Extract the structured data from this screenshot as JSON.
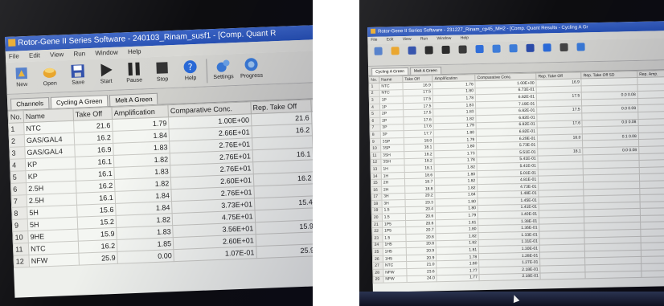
{
  "left": {
    "window_title": "Rotor-Gene II Series Software - 240103_Rinam_susf1 - [Comp. Quant R",
    "menu": [
      "File",
      "Edit",
      "View",
      "Run",
      "Window",
      "Help"
    ],
    "toolbar": [
      {
        "label": "New",
        "icon": "new-icon"
      },
      {
        "label": "Open",
        "icon": "open-icon"
      },
      {
        "label": "Save",
        "icon": "save-icon"
      },
      {
        "label": "Start",
        "icon": "play-icon"
      },
      {
        "label": "Pause",
        "icon": "pause-icon"
      },
      {
        "label": "Stop",
        "icon": "stop-icon"
      },
      {
        "label": "Help",
        "icon": "help-icon"
      },
      {
        "label": "Settings",
        "icon": "settings-icon"
      },
      {
        "label": "Progress",
        "icon": "progress-icon"
      }
    ],
    "tabs": [
      "Channels",
      "Cycling A Green",
      "Melt A Green"
    ],
    "columns": [
      "No.",
      "Name",
      "Take Off",
      "Amplification",
      "Comparative Conc.",
      "Rep. Take Off",
      "R"
    ],
    "rows": [
      [
        "1",
        "NTC",
        "21.6",
        "1.79",
        "1.00E+00",
        "21.6"
      ],
      [
        "2",
        "GAS/GAL4",
        "16.2",
        "1.84",
        "2.66E+01",
        "16.2"
      ],
      [
        "3",
        "GAS/GAL4",
        "16.9",
        "1.83",
        "2.76E+01",
        ""
      ],
      [
        "4",
        "KP",
        "16.1",
        "1.82",
        "2.76E+01",
        "16.1"
      ],
      [
        "5",
        "KP",
        "16.1",
        "1.83",
        "2.76E+01",
        ""
      ],
      [
        "6",
        "2.5H",
        "16.2",
        "1.82",
        "2.60E+01",
        "16.2"
      ],
      [
        "7",
        "2.5H",
        "16.1",
        "1.84",
        "2.76E+01",
        ""
      ],
      [
        "8",
        "5H",
        "15.6",
        "1.84",
        "3.73E+01",
        "15.4"
      ],
      [
        "9",
        "5H",
        "15.2",
        "1.82",
        "4.75E+01",
        ""
      ],
      [
        "10",
        "9HE",
        "15.9",
        "1.83",
        "3.56E+01",
        "15.9"
      ],
      [
        "11",
        "NTC",
        "16.2",
        "1.85",
        "2.60E+01",
        ""
      ],
      [
        "12",
        "NFW",
        "25.9",
        "0.00",
        "1.07E-01",
        "25.9"
      ]
    ]
  },
  "right": {
    "window_title": "Rotor-Gene II Series Software - 231227_Rinam_cp45_MH2 - [Comp. Quant Results - Cycling A Gr",
    "menu": [
      "File",
      "Edit",
      "View",
      "Run",
      "Window",
      "Help"
    ],
    "toolbar": [
      "new-icon",
      "open-icon",
      "save-icon",
      "play-icon",
      "pause-icon",
      "stop-icon",
      "help-icon",
      "settings-icon",
      "progress-icon",
      "hide-icon",
      "report-icon",
      "cursor-icon",
      "export-icon"
    ],
    "tabs": [
      "Cycling A Green",
      "Melt A Green"
    ],
    "columns": [
      "No.",
      "Name",
      "Take Off",
      "Amplification",
      "Comparative Conc.",
      "Rep. Take Off",
      "Rep. Take Off SD",
      "Rep. Amp."
    ],
    "rows": [
      [
        "1",
        "NTC",
        "16.9",
        "1.78",
        "1.00E+00",
        "16.9",
        "",
        "1.78"
      ],
      [
        "2",
        "NTC",
        "17.5",
        "1.80",
        "6.73E-01",
        "",
        "",
        ""
      ],
      [
        "3",
        "1P",
        "17.5",
        "1.78",
        "6.82E-01",
        "17.5",
        "0.0  0.08",
        "1.80"
      ],
      [
        "4",
        "1P",
        "17.5",
        "1.83",
        "7.19E-01",
        "",
        "",
        ""
      ],
      [
        "5",
        "2P",
        "17.5",
        "1.83",
        "6.82E-01",
        "17.5",
        "0.0  0.08",
        ""
      ],
      [
        "6",
        "2P",
        "17.6",
        "1.82",
        "6.82E-01",
        "",
        "",
        ""
      ],
      [
        "7",
        "3P",
        "17.6",
        "1.79",
        "6.82E-01",
        "17.6",
        "0.0  0.08",
        ""
      ],
      [
        "8",
        "3P",
        "17.7",
        "1.80",
        "6.82E-01",
        "",
        "",
        ""
      ],
      [
        "9",
        "3SP",
        "18.0",
        "1.79",
        "6.29E-01",
        "18.0",
        "0.1  0.08",
        "1.78"
      ],
      [
        "10",
        "3SP",
        "18.1",
        "1.80",
        "5.73E-01",
        "",
        "",
        ""
      ],
      [
        "11",
        "3SH",
        "18.2",
        "1.73",
        "5.51E-01",
        "18.1",
        "0.0  0.08",
        ""
      ],
      [
        "12",
        "3SH",
        "18.2",
        "1.78",
        "5.41E-01",
        "",
        "",
        ""
      ],
      [
        "13",
        "1H",
        "18.1",
        "1.82",
        "5.41E-01",
        "",
        "",
        ""
      ],
      [
        "14",
        "1H",
        "18.6",
        "1.80",
        "5.01E-01",
        "",
        "",
        ""
      ],
      [
        "15",
        "2H",
        "18.7",
        "1.82",
        "4.81E-01",
        "",
        "",
        ""
      ],
      [
        "16",
        "2H",
        "18.8",
        "1.82",
        "4.73E-01",
        "",
        "",
        ""
      ],
      [
        "17",
        "3H",
        "20.2",
        "1.84",
        "1.48E-01",
        "",
        "",
        ""
      ],
      [
        "18",
        "3H",
        "20.3",
        "1.80",
        "1.45E-01",
        "",
        "",
        ""
      ],
      [
        "19",
        "1.5",
        "20.4",
        "1.80",
        "1.41E-01",
        "",
        "",
        ""
      ],
      [
        "20",
        "1.5",
        "20.6",
        "1.79",
        "1.40E-01",
        "",
        "",
        ""
      ],
      [
        "21",
        "1P5",
        "20.6",
        "1.81",
        "1.38E-01",
        "",
        "",
        ""
      ],
      [
        "22",
        "1P5",
        "20.7",
        "1.80",
        "1.36E-01",
        "",
        "",
        ""
      ],
      [
        "23",
        "1.5",
        "20.8",
        "1.82",
        "1.33E-01",
        "",
        "",
        ""
      ],
      [
        "24",
        "1H5",
        "20.8",
        "1.82",
        "1.31E-01",
        "",
        "",
        ""
      ],
      [
        "25",
        "1H5",
        "20.9",
        "1.81",
        "1.30E-01",
        "",
        "",
        ""
      ],
      [
        "26",
        "1H5",
        "20.9",
        "1.78",
        "1.28E-01",
        "",
        "",
        ""
      ],
      [
        "27",
        "NTC",
        "21.0",
        "1.80",
        "1.27E-01",
        "",
        "",
        ""
      ],
      [
        "28",
        "NFW",
        "23.6",
        "1.77",
        "2.18E-01",
        "",
        "",
        "0.90"
      ],
      [
        "29",
        "NFW",
        "24.0",
        "1.77",
        "2.18E-01",
        "",
        "",
        ""
      ]
    ]
  },
  "colors": {
    "titlebar": "#2650b4",
    "toolbar": "#d4d4d0",
    "grid_bg": "#f4f6f2",
    "bezel": "#0d0d10"
  }
}
